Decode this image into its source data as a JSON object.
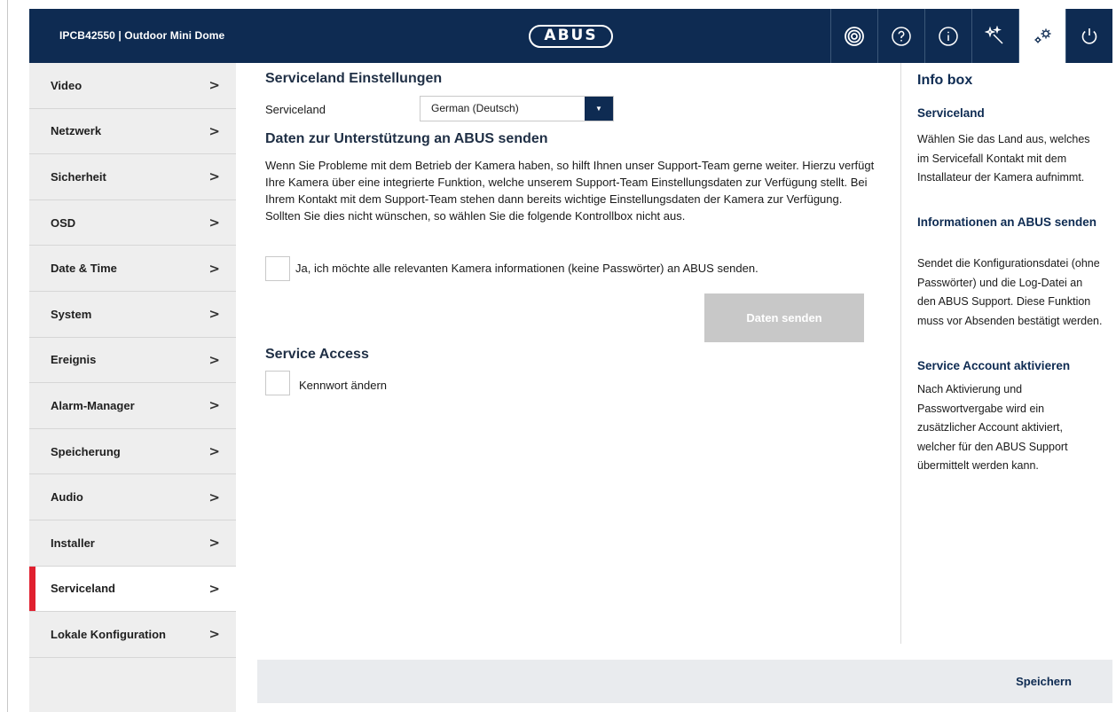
{
  "header": {
    "title": "IPCB42550 | Outdoor Mini Dome",
    "logo_text": "ABUS",
    "icons": [
      "live-view-icon",
      "help-icon",
      "info-icon",
      "wizard-icon",
      "settings-icon",
      "power-icon"
    ],
    "active_icon": "settings-icon"
  },
  "sidebar": {
    "items": [
      {
        "label": "Video"
      },
      {
        "label": "Netzwerk"
      },
      {
        "label": "Sicherheit"
      },
      {
        "label": "OSD"
      },
      {
        "label": "Date & Time"
      },
      {
        "label": "System"
      },
      {
        "label": "Ereignis"
      },
      {
        "label": "Alarm-Manager"
      },
      {
        "label": "Speicherung"
      },
      {
        "label": "Audio"
      },
      {
        "label": "Installer"
      },
      {
        "label": "Serviceland"
      },
      {
        "label": "Lokale Konfiguration"
      }
    ],
    "active": "Serviceland",
    "chevron": ">"
  },
  "main": {
    "section1_title": "Serviceland Einstellungen",
    "serviceland_label": "Serviceland",
    "serviceland_value": "German (Deutsch)",
    "section2_title": "Daten zur Unterstützung an ABUS senden",
    "paragraph": "Wenn Sie Probleme mit dem Betrieb der Kamera haben, so hilft Ihnen unser Support-Team gerne weiter. Hierzu verfügt Ihre Kamera über eine integrierte Funktion, welche unserem Support-Team Einstellungsdaten zur Verfügung stellt. Bei Ihrem Kontakt mit dem Support-Team stehen dann bereits wichtige Einstellungsdaten der Kamera zur Verfügung. Sollten Sie dies nicht wünschen, so wählen Sie die folgende Kontrollbox nicht aus.",
    "consent_label": "Ja, ich möchte alle relevanten Kamera informationen (keine Passwörter) an ABUS senden.",
    "send_button": "Daten senden",
    "section3_title": "Service Access",
    "password_label": "Kennwort ändern"
  },
  "infobox": {
    "title": "Info box",
    "h1": "Serviceland",
    "p1": "Wählen Sie das Land aus, welches im Servicefall Kontakt mit dem Installateur der Kamera aufnimmt.",
    "h2": "Informationen an ABUS senden",
    "p2": "Sendet die Konfigurationsdatei (ohne Passwörter) und die Log-Datei an den ABUS Support. Diese Funktion muss vor Absenden bestätigt werden.",
    "h3": "Service Account aktivieren",
    "p3": "Nach Aktivierung und Passwortvergabe wird ein zusätzlicher Account aktiviert, welcher für den ABUS Support übermittelt werden kann."
  },
  "footer": {
    "save_label": "Speichern"
  },
  "colors": {
    "header_bg": "#0e2b52",
    "active_marker": "#e0202f",
    "sidebar_bg": "#eeeeee",
    "disabled_button": "#c8c8c8"
  }
}
